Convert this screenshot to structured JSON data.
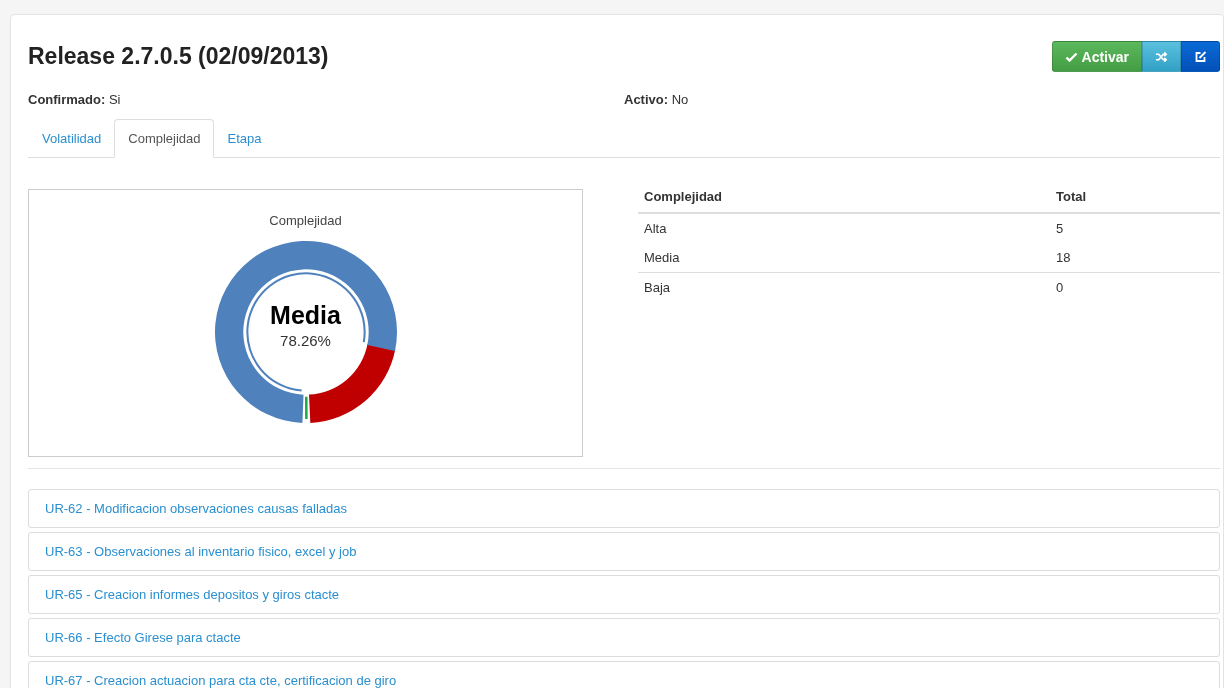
{
  "title": "Release 2.7.0.5 (02/09/2013)",
  "actions": [
    {
      "kind": "activate",
      "label": "Activar"
    },
    {
      "kind": "shuffle"
    },
    {
      "kind": "edit"
    }
  ],
  "fields": [
    {
      "label": "Confirmado:",
      "value": "Si"
    },
    {
      "label": "Activo:",
      "value": "No"
    }
  ],
  "tabs": [
    {
      "label": "Volatilidad",
      "selected": false
    },
    {
      "label": "Complejidad",
      "selected": true
    },
    {
      "label": "Etapa",
      "selected": false
    }
  ],
  "chart": {
    "center_label": "Media",
    "center_value": "78.26%",
    "chart_data": {
      "type": "donut",
      "title": "Complejidad",
      "values": [
        21.74,
        0,
        78.26
      ],
      "colors": [
        "#c00000",
        "#22a84a",
        "#4f81bd"
      ]
    }
  },
  "table": {
    "columns": [
      "Complejidad",
      "Total"
    ],
    "rows": [
      [
        "Alta",
        "5"
      ],
      [
        "Media",
        "18"
      ],
      [
        "Baja",
        "0"
      ]
    ]
  },
  "items": [
    "UR-62 - Modificacion observaciones causas falladas",
    "UR-63 - Observaciones al inventario fisico, excel y job",
    "UR-65 - Creacion informes depositos y giros ctacte",
    "UR-66 - Efecto Girese para ctacte",
    "UR-67 - Creacion actuacion para cta cte, certificacion de giro"
  ]
}
